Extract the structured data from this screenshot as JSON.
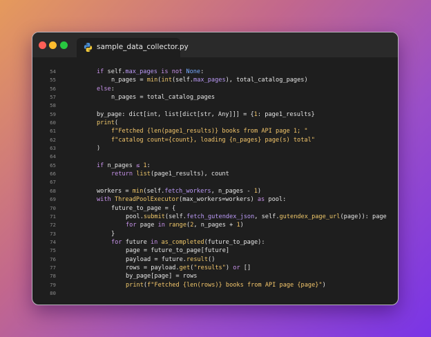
{
  "window": {
    "tab_label": "sample_data_collector.py",
    "tab_icon": "python-icon"
  },
  "code_lines": [
    {
      "n": "54",
      "indent": 0,
      "tokens": [
        [
          "kwp",
          "if"
        ],
        [
          "id",
          " self."
        ],
        [
          "attr",
          "max_pages"
        ],
        [
          "id",
          " "
        ],
        [
          "kwp",
          "is not"
        ],
        [
          "id",
          " "
        ],
        [
          "kw",
          "None"
        ],
        [
          "id",
          ":"
        ]
      ]
    },
    {
      "n": "55",
      "indent": 1,
      "tokens": [
        [
          "id",
          "n_pages = "
        ],
        [
          "fn",
          "min"
        ],
        [
          "id",
          "("
        ],
        [
          "fn",
          "int"
        ],
        [
          "id",
          "(self."
        ],
        [
          "attr",
          "max_pages"
        ],
        [
          "id",
          "), total_catalog_pages)"
        ]
      ]
    },
    {
      "n": "56",
      "indent": 0,
      "tokens": [
        [
          "kwp",
          "else"
        ],
        [
          "id",
          ":"
        ]
      ]
    },
    {
      "n": "57",
      "indent": 1,
      "tokens": [
        [
          "id",
          "n_pages = total_catalog_pages"
        ]
      ]
    },
    {
      "n": "58",
      "indent": 0,
      "tokens": []
    },
    {
      "n": "59",
      "indent": 0,
      "tokens": [
        [
          "id",
          "by_page: dict[int, list[dict[str, Any]]] = {"
        ],
        [
          "num",
          "1"
        ],
        [
          "id",
          ": page1_results}"
        ]
      ]
    },
    {
      "n": "60",
      "indent": 0,
      "tokens": [
        [
          "fn",
          "print"
        ],
        [
          "id",
          "("
        ]
      ]
    },
    {
      "n": "61",
      "indent": 1,
      "tokens": [
        [
          "str",
          "f\"Fetched {"
        ],
        [
          "fn",
          "len"
        ],
        [
          "str",
          "(page1_results)} books from API page 1; \""
        ]
      ]
    },
    {
      "n": "62",
      "indent": 1,
      "tokens": [
        [
          "str",
          "f\"catalog count={count}, loading {n_pages} page(s) total\""
        ]
      ]
    },
    {
      "n": "63",
      "indent": 0,
      "tokens": [
        [
          "id",
          ")"
        ]
      ]
    },
    {
      "n": "64",
      "indent": 0,
      "tokens": []
    },
    {
      "n": "65",
      "indent": 0,
      "tokens": [
        [
          "kwp",
          "if"
        ],
        [
          "id",
          " n_pages "
        ],
        [
          "kwp",
          "≤"
        ],
        [
          "id",
          " "
        ],
        [
          "num",
          "1"
        ],
        [
          "id",
          ":"
        ]
      ]
    },
    {
      "n": "66",
      "indent": 1,
      "tokens": [
        [
          "kwp",
          "return"
        ],
        [
          "id",
          " "
        ],
        [
          "fn",
          "list"
        ],
        [
          "id",
          "(page1_results), count"
        ]
      ]
    },
    {
      "n": "67",
      "indent": 0,
      "tokens": []
    },
    {
      "n": "68",
      "indent": 0,
      "tokens": [
        [
          "id",
          "workers = "
        ],
        [
          "fn",
          "min"
        ],
        [
          "id",
          "(self."
        ],
        [
          "attr",
          "fetch_workers"
        ],
        [
          "id",
          ", n_pages - "
        ],
        [
          "num",
          "1"
        ],
        [
          "id",
          ")"
        ]
      ]
    },
    {
      "n": "69",
      "indent": 0,
      "tokens": [
        [
          "kwp",
          "with"
        ],
        [
          "id",
          " "
        ],
        [
          "fn",
          "ThreadPoolExecutor"
        ],
        [
          "id",
          "(max_workers=workers) "
        ],
        [
          "kwp",
          "as"
        ],
        [
          "id",
          " pool:"
        ]
      ]
    },
    {
      "n": "70",
      "indent": 1,
      "tokens": [
        [
          "id",
          "future_to_page = {"
        ]
      ]
    },
    {
      "n": "71",
      "indent": 2,
      "tokens": [
        [
          "id",
          "pool."
        ],
        [
          "fn",
          "submit"
        ],
        [
          "id",
          "(self."
        ],
        [
          "attr",
          "fetch_gutendex_json"
        ],
        [
          "id",
          ", self."
        ],
        [
          "fn",
          "gutendex_page_url"
        ],
        [
          "id",
          "(page)): page"
        ]
      ]
    },
    {
      "n": "72",
      "indent": 2,
      "tokens": [
        [
          "kwp",
          "for"
        ],
        [
          "id",
          " page "
        ],
        [
          "kwp",
          "in"
        ],
        [
          "id",
          " "
        ],
        [
          "fn",
          "range"
        ],
        [
          "id",
          "("
        ],
        [
          "num",
          "2"
        ],
        [
          "id",
          ", n_pages + "
        ],
        [
          "num",
          "1"
        ],
        [
          "id",
          ")"
        ]
      ]
    },
    {
      "n": "73",
      "indent": 1,
      "tokens": [
        [
          "id",
          "}"
        ]
      ]
    },
    {
      "n": "74",
      "indent": 1,
      "tokens": [
        [
          "kwp",
          "for"
        ],
        [
          "id",
          " future "
        ],
        [
          "kwp",
          "in"
        ],
        [
          "id",
          " "
        ],
        [
          "fn",
          "as_completed"
        ],
        [
          "id",
          "(future_to_page):"
        ]
      ]
    },
    {
      "n": "75",
      "indent": 2,
      "tokens": [
        [
          "id",
          "page = future_to_page[future]"
        ]
      ]
    },
    {
      "n": "76",
      "indent": 2,
      "tokens": [
        [
          "id",
          "payload = future."
        ],
        [
          "fn",
          "result"
        ],
        [
          "id",
          "()"
        ]
      ]
    },
    {
      "n": "77",
      "indent": 2,
      "tokens": [
        [
          "id",
          "rows = payload."
        ],
        [
          "fn",
          "get"
        ],
        [
          "id",
          "("
        ],
        [
          "str",
          "\"results\""
        ],
        [
          "id",
          ") "
        ],
        [
          "kwp",
          "or"
        ],
        [
          "id",
          " []"
        ]
      ]
    },
    {
      "n": "78",
      "indent": 2,
      "tokens": [
        [
          "id",
          "by_page[page] = rows"
        ]
      ]
    },
    {
      "n": "79",
      "indent": 2,
      "tokens": [
        [
          "fn",
          "print"
        ],
        [
          "id",
          "("
        ],
        [
          "str",
          "f\"Fetched {"
        ],
        [
          "fn",
          "len"
        ],
        [
          "str",
          "(rows)} books from API page {page}\""
        ],
        [
          "id",
          ")"
        ]
      ]
    },
    {
      "n": "80",
      "indent": 0,
      "tokens": []
    }
  ]
}
